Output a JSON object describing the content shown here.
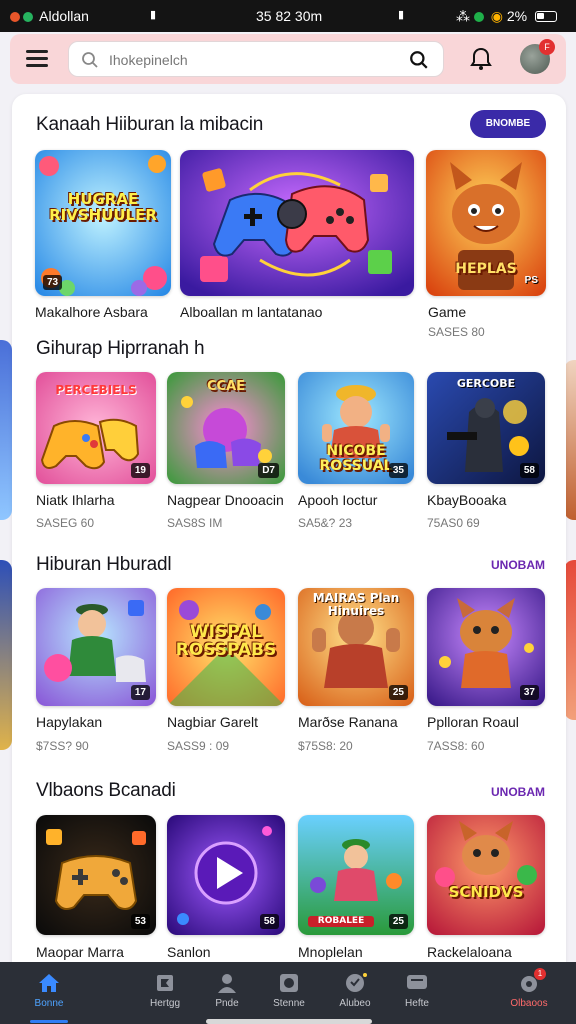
{
  "status_bar": {
    "app_name": "Aldollan",
    "time": "35 82 30m",
    "battery": "2%"
  },
  "search": {
    "placeholder": "Ihokepinelch"
  },
  "notifications": {
    "avatar_badge": "F"
  },
  "sections": [
    {
      "title": "Kanaah Hiiburan la mibacin",
      "action": "BNOMBE"
    },
    {
      "title": "Gihurap Hiprranah h"
    },
    {
      "title": "Hiburan Hburadl",
      "action": "UNOBAM"
    },
    {
      "title": "Vlbaons Bcanadi",
      "action": "UNOBAM"
    }
  ],
  "featured": [
    {
      "name": "Makalhore Asbara",
      "art": "HUGRAE RIVSHUULER",
      "badge": "73"
    },
    {
      "name": "Alboallan m lantatanao"
    },
    {
      "name": "Game",
      "sub": "SASES 80",
      "art": "HEPLAS",
      "badge": "PS"
    }
  ],
  "row1": [
    {
      "name": "Niatk Ihlarha",
      "sub": "SASEG 60",
      "art": "PERCEBIELS",
      "badge": "19"
    },
    {
      "name": "Nagpear Dnooacin",
      "sub": "SAS8S IM",
      "art": "CCAE",
      "badge": "D7"
    },
    {
      "name": "Apooh Ioctur",
      "sub": "SA5&? 23",
      "art": "NICOBE ROSSUAL",
      "badge": "35"
    },
    {
      "name": "KbayBooaka",
      "sub": "75AS0 69",
      "art": "GERCOBE",
      "badge": "58"
    }
  ],
  "row2": [
    {
      "name": "Hapylakan",
      "sub": "$7SS? 90",
      "badge": "17"
    },
    {
      "name": "Nagbiar Garelt",
      "sub": "SASS9 : 09",
      "art": "WISPAL ROSSPABS"
    },
    {
      "name": "Marðse Ranana",
      "sub": "$75S8: 20",
      "art": "MAIRAS Plan Hinuires",
      "badge": "25"
    },
    {
      "name": "Pplloran Roaul",
      "sub": "7ASS8: 60",
      "badge": "37"
    }
  ],
  "row3": [
    {
      "name": "Maopar Marra",
      "badge": "53"
    },
    {
      "name": "Sanlon",
      "badge": "58"
    },
    {
      "name": "Mnoplelan",
      "art": "ROBALEE",
      "badge": "25"
    },
    {
      "name": "Rackelaloana",
      "art": "SCNIDVS"
    }
  ],
  "bottom_nav": [
    {
      "label": "Bonne",
      "active": true
    },
    {
      "label": "Hertgg"
    },
    {
      "label": "Pnde"
    },
    {
      "label": "Stenne"
    },
    {
      "label": "Alubeo"
    },
    {
      "label": "Hefte"
    },
    {
      "label": "Olbaoos",
      "badge": "1"
    }
  ],
  "colors": {
    "accent": "#3a2aa8",
    "link": "#6b27b0",
    "appbar": "#f9d6d8",
    "nav_bg": "#2b2f37",
    "nav_active": "#4ea3ff"
  }
}
